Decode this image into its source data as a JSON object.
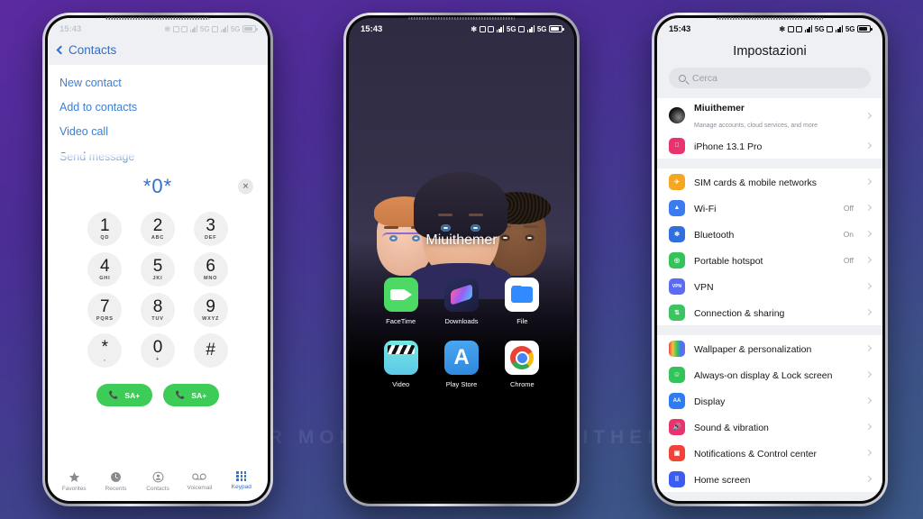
{
  "background": {
    "watermark": "VISIT FOR MORE THEMES - MIUITHEMER.COM",
    "gradient_from": "#5b2aa0",
    "gradient_to": "#3d5a8a"
  },
  "phone1": {
    "statusbar": {
      "time": "15:43"
    },
    "back_label": "Contacts",
    "suggestions": [
      {
        "label": "New contact"
      },
      {
        "label": "Add to contacts"
      },
      {
        "label": "Video call"
      },
      {
        "label": "Send message"
      }
    ],
    "dialed_number": "*0*",
    "clear_icon": "✕",
    "keypad": [
      {
        "digit": "1",
        "letters": "QD"
      },
      {
        "digit": "2",
        "letters": "ABC"
      },
      {
        "digit": "3",
        "letters": "DEF"
      },
      {
        "digit": "4",
        "letters": "GHI"
      },
      {
        "digit": "5",
        "letters": "JKI"
      },
      {
        "digit": "6",
        "letters": "MNO"
      },
      {
        "digit": "7",
        "letters": "PQRS"
      },
      {
        "digit": "8",
        "letters": "TUV"
      },
      {
        "digit": "9",
        "letters": "WXYZ"
      },
      {
        "digit": "*",
        "letters": ","
      },
      {
        "digit": "0",
        "letters": "+"
      },
      {
        "digit": "#",
        "letters": ""
      }
    ],
    "call_buttons": [
      {
        "label": "SA+"
      },
      {
        "label": "SA+"
      }
    ],
    "tabs": [
      {
        "label": "Favorites",
        "icon": "star-icon",
        "active": false
      },
      {
        "label": "Recents",
        "icon": "clock-icon",
        "active": false
      },
      {
        "label": "Contacts",
        "icon": "person-icon",
        "active": false
      },
      {
        "label": "Voicemail",
        "icon": "voicemail-icon",
        "active": false
      },
      {
        "label": "Keypad",
        "icon": "keypad-icon",
        "active": true
      }
    ]
  },
  "phone2": {
    "statusbar": {
      "time": "15:43",
      "network1": "5G",
      "network2": "5G"
    },
    "wallpaper_label": "Miuithemer",
    "apps": [
      {
        "label": "FaceTime",
        "icon": "facetime-icon"
      },
      {
        "label": "Downloads",
        "icon": "downloads-icon"
      },
      {
        "label": "File",
        "icon": "folder-icon"
      },
      {
        "label": "Video",
        "icon": "video-icon"
      },
      {
        "label": "Play Store",
        "icon": "play-store-icon"
      },
      {
        "label": "Chrome",
        "icon": "chrome-icon"
      }
    ]
  },
  "phone3": {
    "statusbar": {
      "time": "15:43",
      "network1": "5G",
      "network2": "5G"
    },
    "title": "Impostazioni",
    "search_placeholder": "Cerca",
    "account": {
      "name": "Miuithemer",
      "subtitle": "Manage accounts, cloud services, and more"
    },
    "device": {
      "label": "iPhone 13.1 Pro",
      "icon": "apple-icon",
      "color": "#e8336d"
    },
    "group1": [
      {
        "label": "SIM cards & mobile networks",
        "value": "",
        "icon": "airplane-icon",
        "color": "#f5a623"
      },
      {
        "label": "Wi-Fi",
        "value": "Off",
        "icon": "wifi-icon",
        "color": "#3a7bf0"
      },
      {
        "label": "Bluetooth",
        "value": "On",
        "icon": "bluetooth-icon",
        "color": "#2f6fe0"
      },
      {
        "label": "Portable hotspot",
        "value": "Off",
        "icon": "hotspot-icon",
        "color": "#33c35a"
      },
      {
        "label": "VPN",
        "value": "",
        "icon": "vpn-icon",
        "color": "#5b6cf0"
      },
      {
        "label": "Connection & sharing",
        "value": "",
        "icon": "connection-icon",
        "color": "#3cc460"
      }
    ],
    "group2": [
      {
        "label": "Wallpaper & personalization",
        "value": "",
        "icon": "wallpaper-icon",
        "color": "#8a5cf0"
      },
      {
        "label": "Always-on display & Lock screen",
        "value": "",
        "icon": "aod-icon",
        "color": "#33c35a"
      },
      {
        "label": "Display",
        "value": "",
        "icon": "display-icon",
        "color": "#2f7bf0"
      },
      {
        "label": "Sound & vibration",
        "value": "",
        "icon": "sound-icon",
        "color": "#e8336d"
      },
      {
        "label": "Notifications & Control center",
        "value": "",
        "icon": "notifications-icon",
        "color": "#f0443a"
      },
      {
        "label": "Home screen",
        "value": "",
        "icon": "home-screen-icon",
        "color": "#3a5cf0"
      }
    ]
  }
}
